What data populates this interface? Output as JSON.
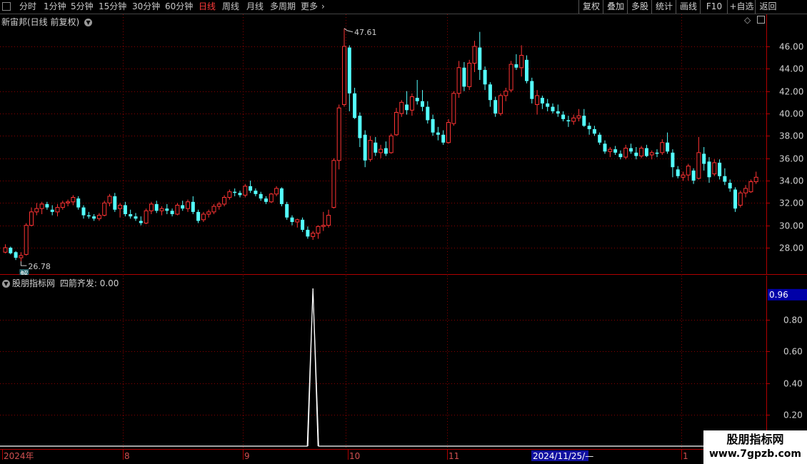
{
  "toolbar": {
    "periods": [
      "分时",
      "1分钟",
      "5分钟",
      "15分钟",
      "30分钟",
      "60分钟",
      "日线",
      "周线",
      "月线",
      "多周期",
      "更多"
    ],
    "active_period": "日线",
    "right_buttons": [
      "复权",
      "叠加",
      "多股",
      "统计",
      "画线",
      "F10",
      "+自选",
      "返回"
    ]
  },
  "main_chart": {
    "title": "新宙邦(日线 前复权)",
    "high_label": "47.61",
    "low_label": "26.78",
    "low_marker": "解",
    "y_ticks": [
      "46.00",
      "44.00",
      "42.00",
      "40.00",
      "38.00",
      "36.00",
      "34.00",
      "32.00",
      "30.00",
      "28.00"
    ],
    "ylim": [
      26.0,
      48.0
    ]
  },
  "indicator": {
    "source": "股朋指标网",
    "label": "四箭齐发",
    "value": "0.00",
    "current_badge": "0.96",
    "y_ticks": [
      "0.80",
      "0.60",
      "0.40",
      "0.20"
    ]
  },
  "x_axis": {
    "labels": [
      "2024年",
      "8",
      "9",
      "10",
      "11",
      "1"
    ],
    "cursor_date": "2024/11/25/—"
  },
  "watermark": {
    "line1": "股朋指标网",
    "line2": "www.7gpzb.com"
  },
  "colors": {
    "up": "#ff3333",
    "down": "#54ffff",
    "grid": "#8b0000",
    "axis": "#b00000",
    "active": "#ff3a3a"
  },
  "chart_data": {
    "type": "candlestick",
    "ohlc": [
      [
        27.6,
        28.3,
        27.5,
        28.0
      ],
      [
        28.0,
        28.1,
        27.4,
        27.5
      ],
      [
        27.6,
        27.7,
        26.9,
        27.1
      ],
      [
        27.1,
        27.6,
        26.78,
        27.3
      ],
      [
        27.4,
        30.2,
        27.3,
        30.0
      ],
      [
        30.0,
        31.6,
        29.9,
        31.2
      ],
      [
        31.2,
        32.0,
        30.9,
        31.5
      ],
      [
        31.5,
        32.1,
        31.0,
        31.9
      ],
      [
        31.9,
        32.1,
        31.4,
        31.6
      ],
      [
        31.4,
        31.8,
        30.9,
        31.2
      ],
      [
        31.2,
        31.9,
        30.8,
        31.6
      ],
      [
        31.6,
        32.2,
        31.4,
        32.0
      ],
      [
        32.0,
        32.3,
        31.7,
        32.1
      ],
      [
        32.1,
        32.7,
        31.8,
        32.5
      ],
      [
        32.4,
        32.6,
        31.4,
        31.6
      ],
      [
        31.6,
        31.8,
        30.6,
        30.9
      ],
      [
        30.9,
        31.2,
        30.6,
        30.8
      ],
      [
        30.8,
        31.0,
        30.4,
        30.6
      ],
      [
        30.6,
        31.1,
        30.4,
        30.9
      ],
      [
        30.9,
        32.2,
        30.8,
        32.0
      ],
      [
        32.0,
        32.8,
        31.7,
        32.6
      ],
      [
        32.6,
        32.9,
        31.2,
        31.4
      ],
      [
        31.5,
        32.0,
        30.7,
        31.8
      ],
      [
        31.8,
        32.1,
        30.8,
        31.0
      ],
      [
        31.0,
        31.4,
        30.6,
        30.8
      ],
      [
        30.8,
        31.1,
        30.4,
        30.6
      ],
      [
        30.4,
        30.8,
        30.0,
        30.2
      ],
      [
        30.2,
        31.5,
        30.1,
        31.3
      ],
      [
        31.3,
        32.1,
        31.0,
        31.9
      ],
      [
        31.9,
        32.2,
        31.1,
        31.3
      ],
      [
        31.3,
        31.7,
        30.9,
        31.5
      ],
      [
        31.5,
        31.9,
        31.0,
        31.3
      ],
      [
        31.3,
        31.5,
        30.8,
        31.0
      ],
      [
        31.0,
        32.0,
        30.9,
        31.8
      ],
      [
        31.8,
        32.2,
        31.3,
        31.5
      ],
      [
        31.5,
        32.3,
        31.2,
        32.1
      ],
      [
        32.1,
        32.6,
        31.0,
        31.2
      ],
      [
        31.2,
        31.4,
        30.2,
        30.4
      ],
      [
        30.5,
        31.2,
        30.3,
        31.0
      ],
      [
        31.0,
        31.4,
        30.7,
        31.2
      ],
      [
        31.2,
        31.9,
        31.0,
        31.7
      ],
      [
        31.7,
        32.1,
        31.4,
        31.9
      ],
      [
        31.9,
        32.7,
        31.7,
        32.5
      ],
      [
        32.5,
        33.2,
        32.3,
        33.0
      ],
      [
        33.0,
        33.3,
        32.6,
        32.9
      ],
      [
        32.9,
        33.1,
        32.5,
        32.7
      ],
      [
        32.7,
        33.7,
        32.5,
        33.5
      ],
      [
        33.5,
        34.0,
        32.9,
        33.1
      ],
      [
        33.1,
        33.3,
        32.6,
        32.8
      ],
      [
        32.8,
        33.0,
        32.2,
        32.4
      ],
      [
        32.4,
        32.6,
        31.9,
        32.1
      ],
      [
        32.1,
        32.9,
        32.0,
        32.8
      ],
      [
        32.8,
        33.5,
        32.6,
        33.3
      ],
      [
        33.3,
        33.4,
        31.7,
        31.9
      ],
      [
        31.9,
        32.1,
        30.5,
        30.7
      ],
      [
        30.7,
        30.9,
        30.0,
        30.3
      ],
      [
        30.3,
        30.6,
        29.8,
        30.5
      ],
      [
        30.5,
        30.7,
        29.4,
        29.6
      ],
      [
        29.6,
        29.9,
        28.8,
        29.0
      ],
      [
        29.0,
        29.5,
        28.7,
        29.3
      ],
      [
        29.3,
        30.0,
        28.8,
        29.9
      ],
      [
        29.9,
        31.2,
        29.5,
        30.0
      ],
      [
        30.0,
        31.4,
        29.8,
        30.9
      ],
      [
        31.6,
        36.0,
        31.5,
        35.8
      ],
      [
        35.8,
        40.8,
        35.0,
        40.5
      ],
      [
        40.8,
        47.61,
        40.6,
        46.0
      ],
      [
        45.9,
        46.1,
        40.2,
        41.8
      ],
      [
        41.8,
        42.3,
        39.5,
        39.6
      ],
      [
        39.8,
        40.1,
        37.0,
        37.8
      ],
      [
        38.1,
        38.5,
        35.2,
        35.8
      ],
      [
        35.9,
        38.0,
        35.7,
        37.6
      ],
      [
        37.4,
        37.9,
        36.2,
        36.5
      ],
      [
        36.5,
        37.2,
        36.0,
        36.8
      ],
      [
        36.9,
        37.5,
        36.2,
        36.4
      ],
      [
        36.5,
        38.2,
        36.4,
        38.0
      ],
      [
        38.1,
        40.5,
        38.0,
        40.1
      ],
      [
        40.0,
        41.2,
        39.7,
        41.0
      ],
      [
        40.8,
        42.0,
        39.9,
        40.3
      ],
      [
        40.3,
        41.8,
        39.8,
        41.5
      ],
      [
        41.4,
        43.0,
        40.8,
        41.1
      ],
      [
        41.1,
        42.1,
        40.2,
        40.6
      ],
      [
        40.6,
        41.1,
        39.1,
        39.4
      ],
      [
        39.5,
        39.9,
        38.0,
        38.3
      ],
      [
        38.3,
        38.8,
        37.6,
        38.1
      ],
      [
        38.1,
        38.5,
        37.2,
        37.4
      ],
      [
        37.4,
        39.5,
        37.3,
        39.2
      ],
      [
        39.1,
        42.0,
        38.9,
        41.8
      ],
      [
        41.8,
        44.7,
        41.4,
        44.1
      ],
      [
        44.1,
        44.6,
        42.0,
        42.4
      ],
      [
        42.4,
        44.8,
        42.1,
        44.5
      ],
      [
        44.5,
        46.5,
        43.7,
        46.0
      ],
      [
        45.9,
        47.3,
        43.0,
        43.9
      ],
      [
        43.9,
        44.2,
        42.1,
        42.6
      ],
      [
        42.6,
        42.8,
        40.6,
        41.2
      ],
      [
        41.2,
        41.5,
        39.7,
        40.0
      ],
      [
        40.0,
        41.8,
        39.8,
        41.6
      ],
      [
        41.6,
        42.3,
        41.1,
        42.0
      ],
      [
        42.1,
        44.7,
        41.9,
        44.4
      ],
      [
        44.4,
        45.3,
        43.9,
        44.1
      ],
      [
        44.1,
        46.1,
        43.3,
        45.2
      ],
      [
        44.8,
        45.2,
        42.7,
        42.9
      ],
      [
        42.9,
        43.2,
        40.9,
        41.3
      ],
      [
        40.8,
        42.1,
        39.9,
        41.6
      ],
      [
        41.4,
        41.6,
        40.4,
        40.9
      ],
      [
        40.9,
        41.3,
        40.2,
        40.6
      ],
      [
        40.6,
        40.9,
        40.0,
        40.2
      ],
      [
        40.2,
        40.8,
        39.7,
        40.0
      ],
      [
        39.9,
        40.2,
        39.3,
        39.5
      ],
      [
        39.4,
        39.8,
        38.8,
        39.3
      ],
      [
        39.3,
        39.9,
        39.0,
        39.6
      ],
      [
        39.6,
        40.4,
        39.3,
        39.8
      ],
      [
        39.8,
        40.4,
        38.8,
        38.9
      ],
      [
        38.9,
        39.2,
        38.1,
        38.6
      ],
      [
        38.6,
        38.9,
        38.0,
        38.2
      ],
      [
        38.1,
        38.3,
        37.2,
        37.4
      ],
      [
        37.3,
        37.6,
        36.4,
        36.6
      ],
      [
        36.6,
        37.0,
        36.1,
        36.8
      ],
      [
        36.8,
        37.1,
        36.3,
        36.5
      ],
      [
        36.4,
        36.7,
        35.9,
        36.1
      ],
      [
        36.1,
        37.2,
        35.9,
        36.9
      ],
      [
        36.9,
        37.3,
        36.4,
        36.6
      ],
      [
        36.5,
        37.0,
        35.9,
        36.2
      ],
      [
        36.2,
        37.1,
        36.0,
        36.9
      ],
      [
        36.9,
        37.2,
        36.1,
        36.2
      ],
      [
        36.3,
        36.7,
        35.9,
        36.5
      ],
      [
        36.5,
        36.8,
        36.1,
        36.4
      ],
      [
        36.5,
        37.7,
        36.3,
        37.4
      ],
      [
        37.4,
        38.3,
        36.4,
        36.6
      ],
      [
        36.5,
        36.8,
        34.3,
        35.2
      ],
      [
        35.0,
        35.3,
        34.2,
        34.4
      ],
      [
        34.3,
        34.8,
        34.0,
        34.5
      ],
      [
        34.5,
        35.5,
        34.0,
        35.3
      ],
      [
        34.9,
        35.1,
        33.7,
        34.0
      ],
      [
        34.2,
        37.9,
        34.1,
        36.5
      ],
      [
        36.4,
        37.0,
        34.9,
        35.5
      ],
      [
        35.7,
        36.1,
        33.8,
        34.3
      ],
      [
        34.6,
        35.9,
        34.4,
        35.6
      ],
      [
        35.6,
        35.9,
        34.1,
        34.4
      ],
      [
        34.4,
        35.1,
        33.6,
        33.9
      ],
      [
        33.8,
        34.1,
        33.0,
        33.3
      ],
      [
        33.2,
        33.4,
        31.2,
        31.5
      ],
      [
        31.8,
        33.1,
        31.6,
        32.9
      ],
      [
        32.9,
        33.6,
        32.5,
        33.3
      ],
      [
        33.0,
        34.1,
        32.9,
        33.9
      ],
      [
        33.9,
        34.8,
        33.7,
        34.3
      ]
    ],
    "indicator_series": {
      "name": "四箭齐发",
      "peak_bar": 59,
      "peak_value": 1.0,
      "baseline": 0.0
    },
    "ylim": [
      26.0,
      48.0
    ],
    "indicator_ylim": [
      0.0,
      1.0
    ]
  }
}
